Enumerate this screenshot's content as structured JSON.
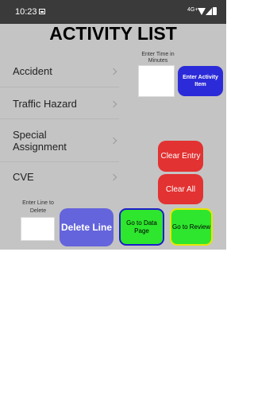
{
  "status_bar": {
    "time": "10:23",
    "signal": "4G+"
  },
  "title": "ACTIVITY LIST",
  "activities": [
    {
      "label": "Accident"
    },
    {
      "label": "Traffic Hazard"
    },
    {
      "label": "Special Assignment"
    },
    {
      "label": "CVE"
    }
  ],
  "time_entry": {
    "label": "Enter Time in Minutes",
    "value": "",
    "button": "Enter Activity Item"
  },
  "buttons": {
    "clear_entry": "Clear Entry",
    "clear_all": "Clear All",
    "delete_line": "Delete Line",
    "data_page": "Go to Data Page",
    "review": "Go to Review"
  },
  "line_entry": {
    "label": "Enter Line to Delete",
    "value": ""
  },
  "colors": {
    "status_bar": "#3a3a3a",
    "background": "#c4c4c4",
    "enter_button": "#2b2bd9",
    "clear_buttons": "#e23232",
    "delete_button": "#6464dc",
    "nav_buttons": "#2ee62e",
    "data_page_border": "#1e1ec8",
    "review_border": "#e6e600"
  }
}
